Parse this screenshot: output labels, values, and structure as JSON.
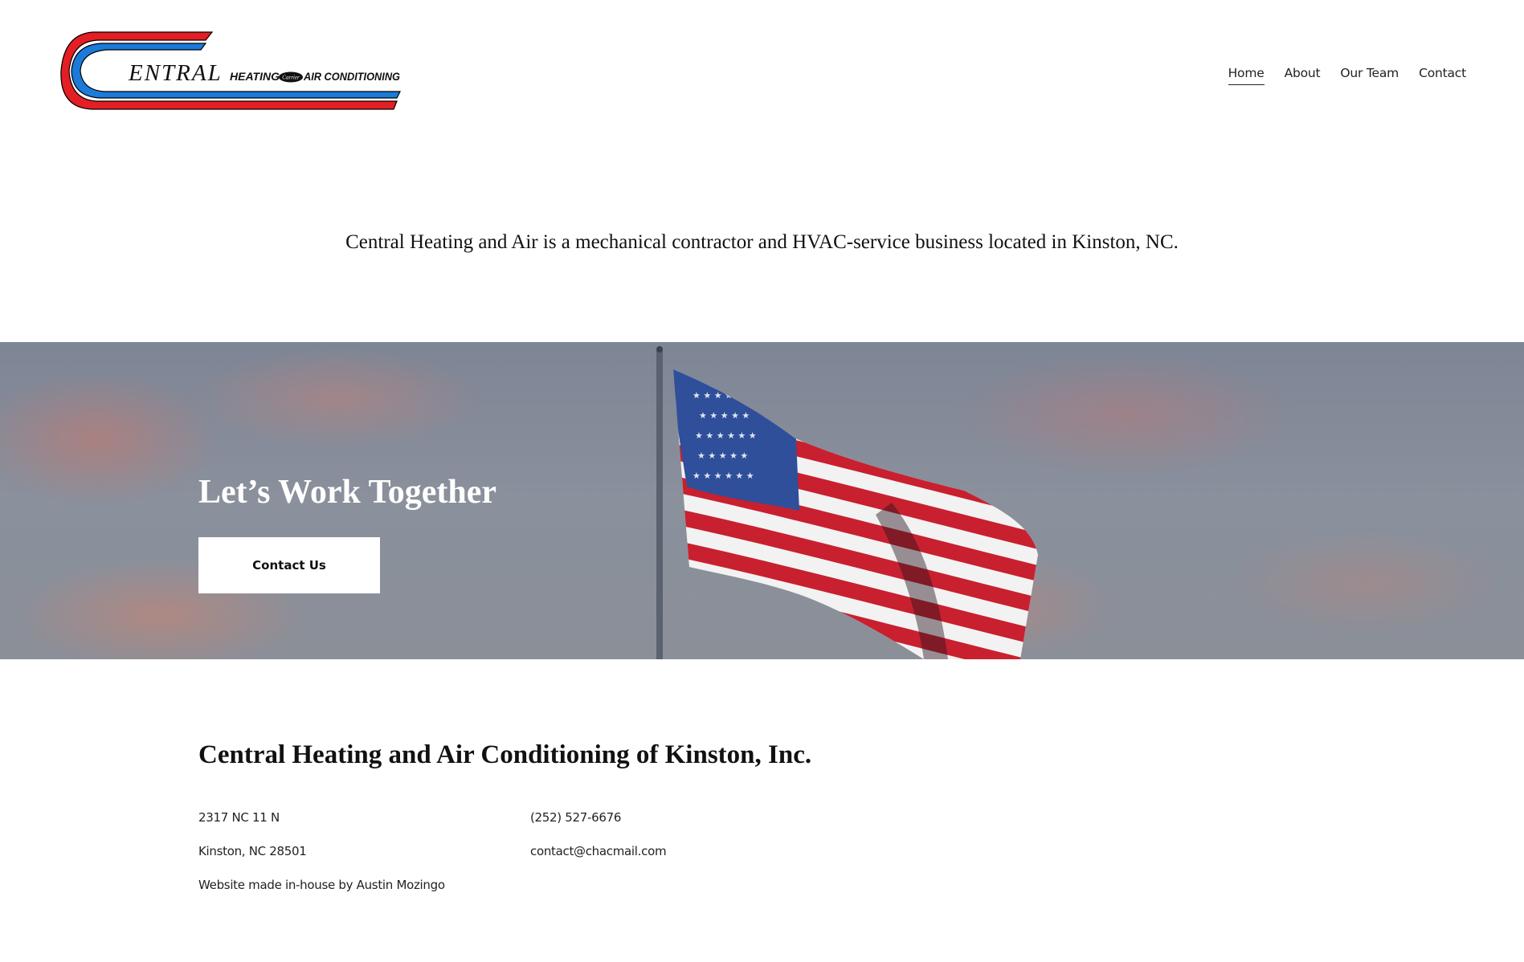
{
  "header": {
    "logo": {
      "word": "ENTRAL",
      "heating": "HEATING",
      "badge": "Carrier",
      "ac": "AIR CONDITIONING",
      "colors": {
        "red": "#e31e24",
        "blue": "#1c7ad8"
      }
    },
    "nav": [
      {
        "label": "Home",
        "active": true
      },
      {
        "label": "About"
      },
      {
        "label": "Our Team"
      },
      {
        "label": "Contact"
      }
    ]
  },
  "intro": {
    "text": "Central Heating and Air is a mechanical contractor and HVAC-service business located in Kinston, NC."
  },
  "hero": {
    "title": "Let’s Work Together",
    "button_label": "Contact Us"
  },
  "footer": {
    "company_name": "Central Heating and Air Conditioning of Kinston, Inc.",
    "address_line1": "2317 NC 11 N",
    "address_line2": "Kinston, NC 28501",
    "credit": "Website made in-house by Austin Mozingo",
    "phone": "(252) 527-6676",
    "email": "contact@chacmail.com"
  }
}
